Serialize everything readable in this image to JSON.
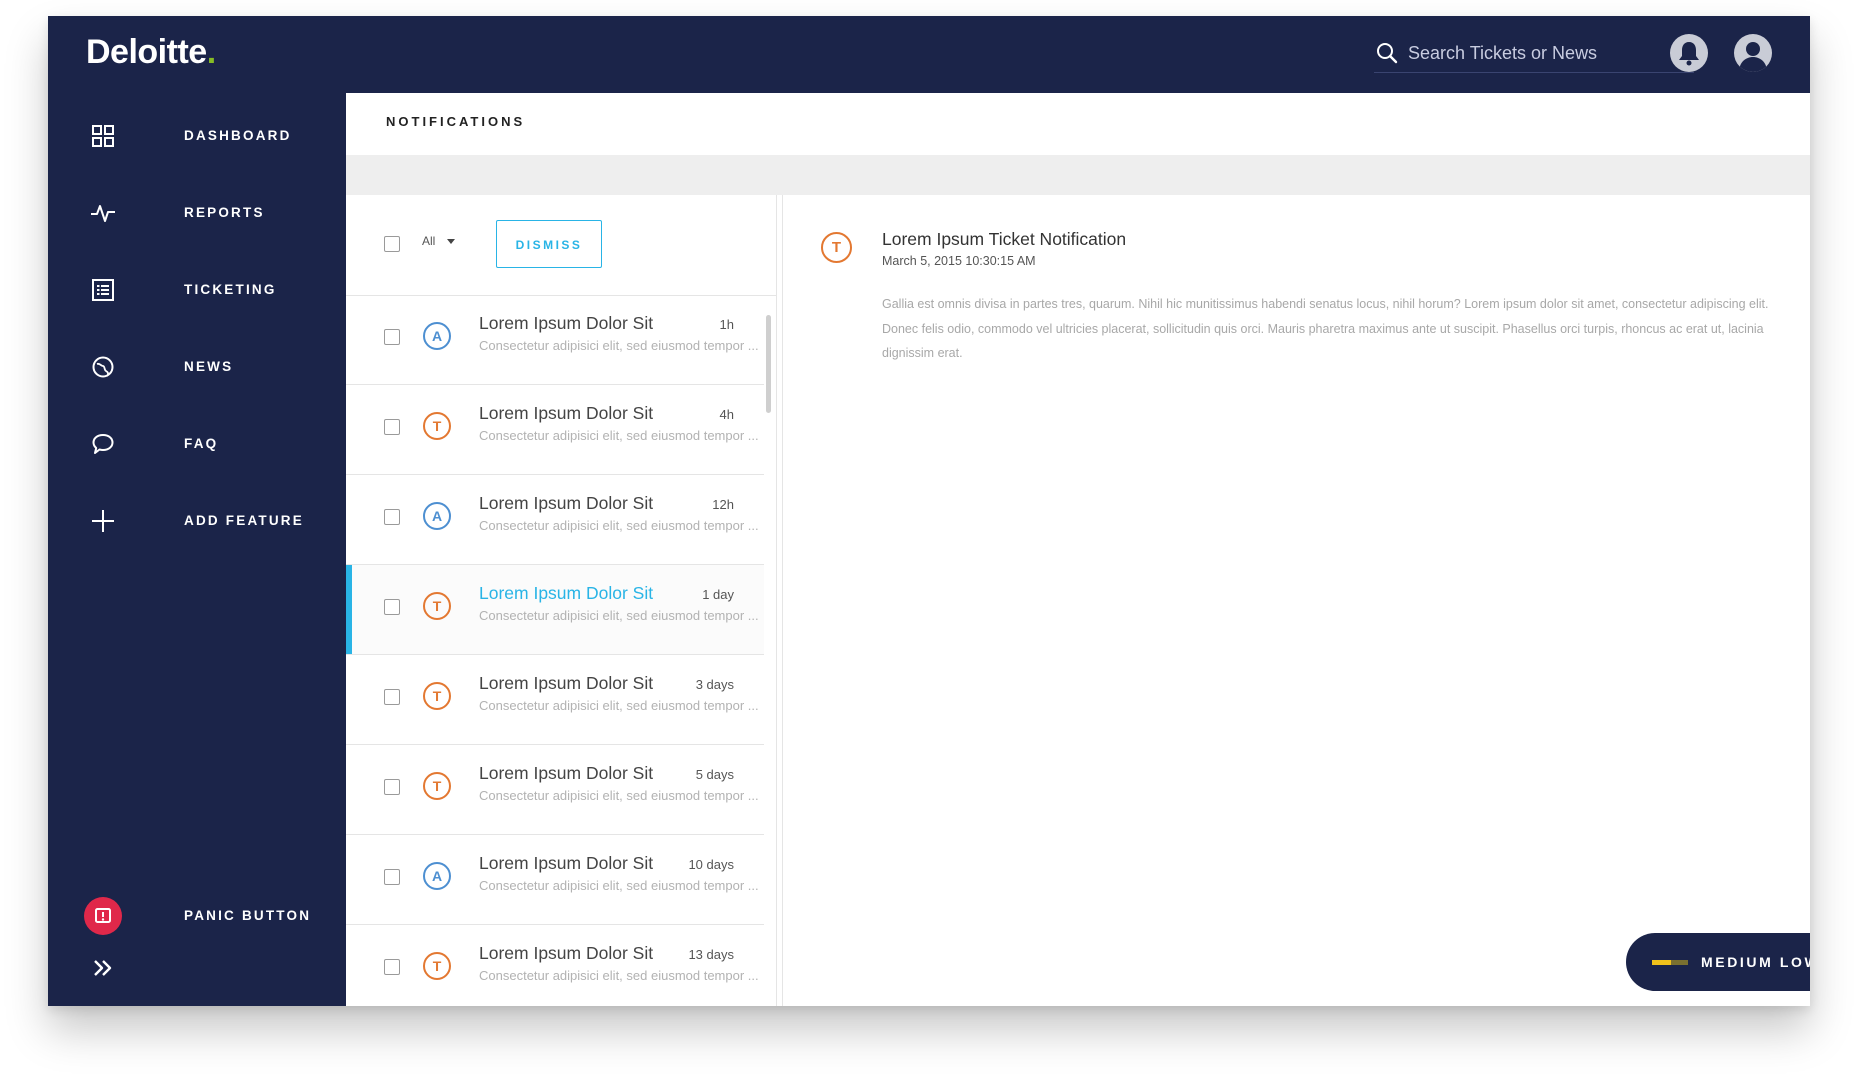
{
  "app": {
    "logo_text": "Deloitte",
    "logo_dot": ".",
    "brand_color": "#1b2449",
    "logo_dot_color": "#86bc25",
    "accent_color": "#29b4e6"
  },
  "header": {
    "search_placeholder": "Search Tickets or News",
    "icons": [
      "search-icon",
      "bell-icon",
      "user-icon"
    ]
  },
  "sidebar": {
    "items": [
      {
        "label": "DASHBOARD",
        "icon": "grid-icon"
      },
      {
        "label": "REPORTS",
        "icon": "pulse-icon"
      },
      {
        "label": "TICKETING",
        "icon": "list-icon"
      },
      {
        "label": "NEWS",
        "icon": "globe-icon"
      },
      {
        "label": "FAQ",
        "icon": "chat-icon"
      },
      {
        "label": "ADD FEATURE",
        "icon": "plus-icon"
      }
    ],
    "panic_label": "PANIC BUTTON",
    "panic_color": "#e0284a"
  },
  "page": {
    "title": "NOTIFICATIONS"
  },
  "list": {
    "filter_label": "All",
    "dismiss_label": "DISMISS",
    "items": [
      {
        "type": "A",
        "title": "Lorem Ipsum Dolor Sit",
        "time": "1h",
        "preview": "Consectetur adipisici elit, sed eiusmod tempor ...",
        "active": false
      },
      {
        "type": "T",
        "title": "Lorem Ipsum Dolor Sit",
        "time": "4h",
        "preview": "Consectetur adipisici elit, sed eiusmod tempor ...",
        "active": false
      },
      {
        "type": "A",
        "title": "Lorem Ipsum Dolor Sit",
        "time": "12h",
        "preview": "Consectetur adipisici elit, sed eiusmod tempor ...",
        "active": false
      },
      {
        "type": "T",
        "title": "Lorem Ipsum Dolor Sit",
        "time": "1 day",
        "preview": "Consectetur adipisici elit, sed eiusmod tempor ...",
        "active": true
      },
      {
        "type": "T",
        "title": "Lorem Ipsum Dolor Sit",
        "time": "3 days",
        "preview": "Consectetur adipisici elit, sed eiusmod tempor ...",
        "active": false
      },
      {
        "type": "T",
        "title": "Lorem Ipsum Dolor Sit",
        "time": "5 days",
        "preview": "Consectetur adipisici elit, sed eiusmod tempor ...",
        "active": false
      },
      {
        "type": "A",
        "title": "Lorem Ipsum Dolor Sit",
        "time": "10 days",
        "preview": "Consectetur adipisici elit, sed eiusmod tempor ...",
        "active": false
      },
      {
        "type": "T",
        "title": "Lorem Ipsum Dolor Sit",
        "time": "13 days",
        "preview": "Consectetur adipisici elit, sed eiusmod tempor ...",
        "active": false
      }
    ]
  },
  "detail": {
    "badge": "T",
    "title": "Lorem Ipsum Ticket Notification",
    "date": "March 5, 2015 10:30:15 AM",
    "body": "Gallia est omnis divisa in partes tres, quarum. Nihil hic munitissimus habendi senatus locus, nihil horum? Lorem ipsum dolor sit amet, consectetur adipiscing elit. Donec felis odio, commodo vel ultricies placerat, sollicitudin quis orci. Mauris pharetra maximus ante ut suscipit. Phasellus orci turpis, rhoncus ac erat ut, lacinia dignissim erat."
  },
  "status": {
    "label": "MEDIUM LOW",
    "colors": [
      "#f0c11b",
      "#7a7030"
    ]
  }
}
